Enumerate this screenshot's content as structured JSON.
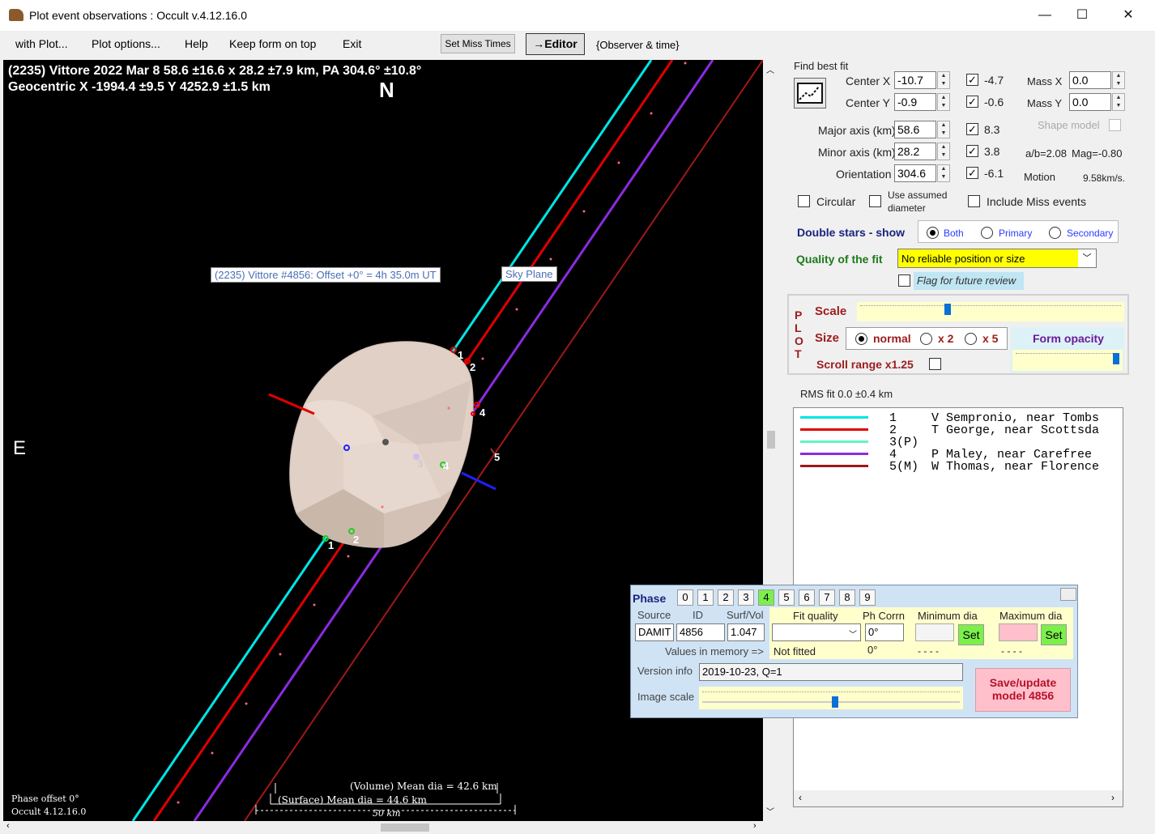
{
  "window": {
    "title": "Plot event observations : Occult v.4.12.16.0",
    "min": "—",
    "max": "☐",
    "close": "✕"
  },
  "menu": {
    "with_plot": "with Plot...",
    "plot_options": "Plot options...",
    "help": "Help",
    "keep_on_top": "Keep form on top",
    "exit": "Exit",
    "set_miss_times": "Set Miss Times",
    "editor": "→Editor",
    "observer_time": "{Observer & time}"
  },
  "plot": {
    "header1": "(2235) Vittore  2022 Mar 8   58.6 ±16.6 x 28.2 ±7.9 km, PA 304.6° ±10.8°",
    "header2": "Geocentric X  -1994.4 ±9.5  Y 4252.9 ±1.5 km",
    "north": "N",
    "east": "E",
    "model_label": "(2235) Vittore #4856: Offset  +0° =  4h 35.0m UT",
    "sky_plane": "Sky Plane",
    "phase_offset": "Phase offset 0°",
    "occult_version": "Occult 4.12.16.0",
    "volume_dia": "(Volume) Mean dia = 42.6 km",
    "surface_dia": "(Surface) Mean dia = 44.6 km",
    "scale_bar": "50 km",
    "chord_labels": [
      "1",
      "2",
      "4",
      "5",
      "3",
      "4",
      "1",
      "2"
    ]
  },
  "fit": {
    "find_best_fit": "Find best fit",
    "center_x_label": "Center X",
    "center_x": "-10.7",
    "center_x_chk": "-4.7",
    "center_y_label": "Center Y",
    "center_y": "-0.9",
    "center_y_chk": "-0.6",
    "mass_x_label": "Mass X",
    "mass_x": "0.0",
    "mass_y_label": "Mass Y",
    "mass_y": "0.0",
    "major_label": "Major axis (km)",
    "major": "58.6",
    "major_chk": "8.3",
    "minor_label": "Minor axis (km)",
    "minor": "28.2",
    "minor_chk": "3.8",
    "orient_label": "Orientation",
    "orient": "304.6",
    "orient_chk": "-6.1",
    "shape_model": "Shape model",
    "ab": "a/b=2.08",
    "mag": "Mag=-0.80",
    "motion_label": "Motion",
    "motion": "9.58km/s.",
    "circular": "Circular",
    "use_assumed1": "Use assumed",
    "use_assumed2": "diameter",
    "include_miss": "Include Miss events",
    "double_stars": "Double stars - show",
    "both": "Both",
    "primary": "Primary",
    "secondary": "Secondary",
    "quality_label": "Quality of the fit",
    "quality": "No reliable position or size",
    "flag_review": "Flag for future review"
  },
  "plot_opts": {
    "vert": [
      "P",
      "L",
      "O",
      "T"
    ],
    "scale": "Scale",
    "size": "Size",
    "normal": "normal",
    "x2": "x 2",
    "x5": "x 5",
    "form_opacity": "Form opacity",
    "scroll_range": "Scroll range x1.25"
  },
  "rms": "RMS fit  0.0 ±0.4 km",
  "legend": [
    {
      "num": "1",
      "name": "V Sempronio, near Tombs",
      "color": "#00e5e5"
    },
    {
      "num": "2",
      "name": "T George, near Scottsda",
      "color": "#e00000"
    },
    {
      "num": "3(P)",
      "name": "",
      "color": "#66f2c2"
    },
    {
      "num": "4",
      "name": "P Maley, near Carefree",
      "color": "#8a2be2"
    },
    {
      "num": "5(M)",
      "name": "W Thomas, near Florence",
      "color": "#a01818"
    }
  ],
  "phase_panel": {
    "phase": "Phase",
    "digits": [
      "0",
      "1",
      "2",
      "3",
      "4",
      "5",
      "6",
      "7",
      "8",
      "9"
    ],
    "source_h": "Source",
    "id_h": "ID",
    "surf_h": "Surf/Vol",
    "source": "DAMIT",
    "id": "4856",
    "surf": "1.047",
    "fit_quality_h": "Fit quality",
    "ph_corr_h": "Ph Corrn",
    "min_dia_h": "Minimum dia",
    "max_dia_h": "Maximum dia",
    "ph_corr": "0°",
    "set": "Set",
    "values_in_memory": "Values in memory =>",
    "not_fitted": "Not fitted",
    "ph_corr_mem": "0°",
    "dashes": "- - - -",
    "version_info_h": "Version info",
    "version_info": "2019-10-23, Q=1",
    "image_scale": "Image scale",
    "save_update": "Save/update",
    "model": "model 4856"
  }
}
